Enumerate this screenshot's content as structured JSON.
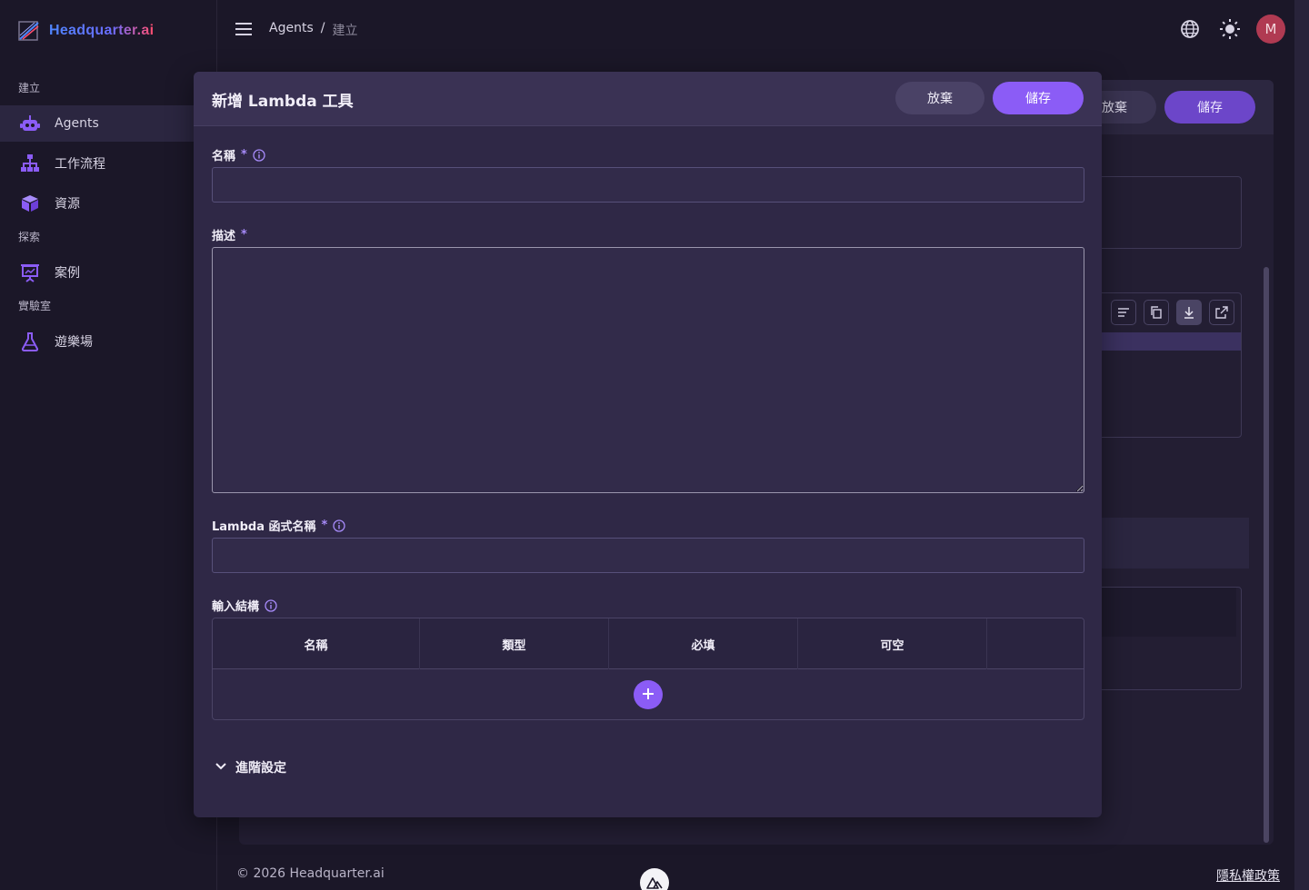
{
  "app": {
    "logo_text": "Headquarter.ai"
  },
  "sidebar": {
    "sections": [
      {
        "label": "建立"
      },
      {
        "label": "探索"
      },
      {
        "label": "實驗室"
      }
    ],
    "items": [
      {
        "label": "Agents",
        "icon": "robot-icon",
        "active": true
      },
      {
        "label": "工作流程",
        "icon": "sitemap-icon"
      },
      {
        "label": "資源",
        "icon": "cube-icon"
      },
      {
        "label": "案例",
        "icon": "presentation-icon"
      },
      {
        "label": "遊樂場",
        "icon": "flask-icon"
      }
    ]
  },
  "header": {
    "breadcrumb": [
      "Agents",
      "/",
      "建立"
    ],
    "icons": [
      "globe-icon",
      "sun-icon"
    ],
    "avatar_initial": "M"
  },
  "background_page": {
    "abandon_label": "放棄",
    "save_label": "儲存"
  },
  "modal": {
    "title": "新增 Lambda 工具",
    "abandon_label": "放棄",
    "save_label": "儲存",
    "fields": {
      "name": {
        "label": "名稱",
        "required": "*",
        "value": ""
      },
      "description": {
        "label": "描述",
        "required": "*",
        "value": ""
      },
      "lambda_name": {
        "label": "Lambda 函式名稱",
        "required": "*",
        "value": ""
      },
      "input_schema": {
        "label": "輸入結構",
        "columns": [
          "名稱",
          "類型",
          "必填",
          "可空"
        ]
      }
    },
    "advanced_label": "進階設定"
  },
  "footer": {
    "copyright": "© 2026 Headquarter.ai",
    "privacy_link": "隱私權政策"
  },
  "colors": {
    "accent": "#8b5cf6",
    "avatar": "#b03a52",
    "background": "#1b1728",
    "modal": "#2f2846"
  }
}
